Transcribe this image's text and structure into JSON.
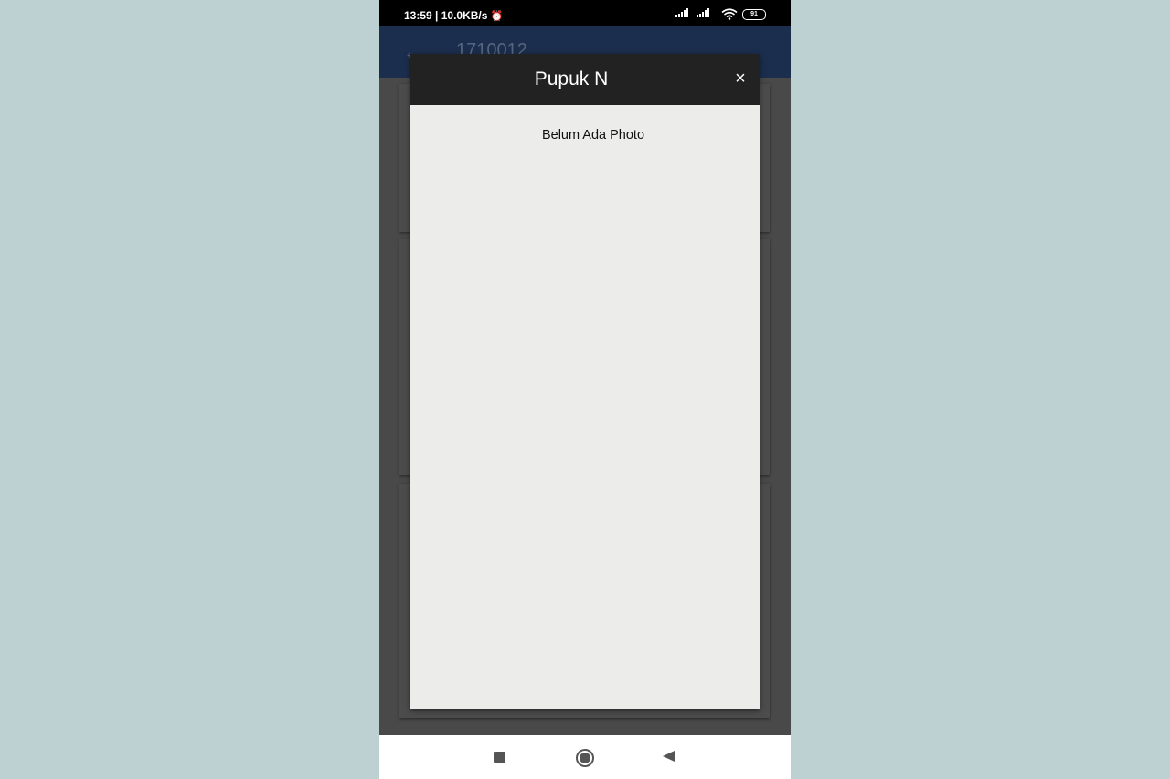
{
  "status_bar": {
    "time": "13:59",
    "separator": " | ",
    "speed": "10.0KB/s",
    "alarm_icon": "alarm-off-icon",
    "battery": "91"
  },
  "app_bar": {
    "back_icon": "arrow-back-icon",
    "title": "1710012"
  },
  "dialog": {
    "title": "Pupuk N",
    "close_label": "×",
    "message": "Belum Ada Photo"
  },
  "nav_bar": {
    "recents_icon": "square-recents-icon",
    "home_icon": "circle-home-icon",
    "back_icon": "triangle-back-icon"
  },
  "colors": {
    "page_bg": "#bdd1d2",
    "app_bar": "#1b2e4e",
    "dialog_header": "#222222",
    "dialog_body": "#ececea",
    "scrim": "#494949"
  }
}
